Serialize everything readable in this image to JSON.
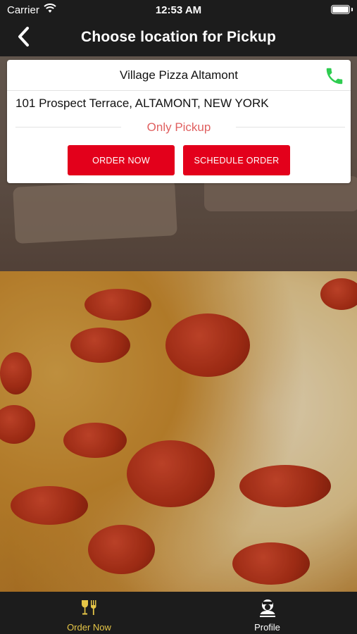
{
  "status_bar": {
    "carrier": "Carrier",
    "time": "12:53 AM"
  },
  "nav": {
    "title": "Choose location for Pickup",
    "back_icon": "chevron-left-icon"
  },
  "location": {
    "name": "Village Pizza Altamont",
    "address": "101 Prospect Terrace, ALTAMONT, NEW YORK",
    "pickup_label": "Only Pickup",
    "order_now_label": "ORDER NOW",
    "schedule_order_label": "SCHEDULE ORDER",
    "phone_icon": "phone-icon"
  },
  "tabs": [
    {
      "label": "Order Now",
      "icon": "fork-glass-icon",
      "active": true
    },
    {
      "label": "Profile",
      "icon": "chef-avatar-icon",
      "active": false
    }
  ],
  "colors": {
    "bar_background": "#1c1c1c",
    "button_red": "#e3001b",
    "pickup_text": "#e06060",
    "phone_green": "#2ecc50",
    "active_tab": "#e5c547"
  }
}
